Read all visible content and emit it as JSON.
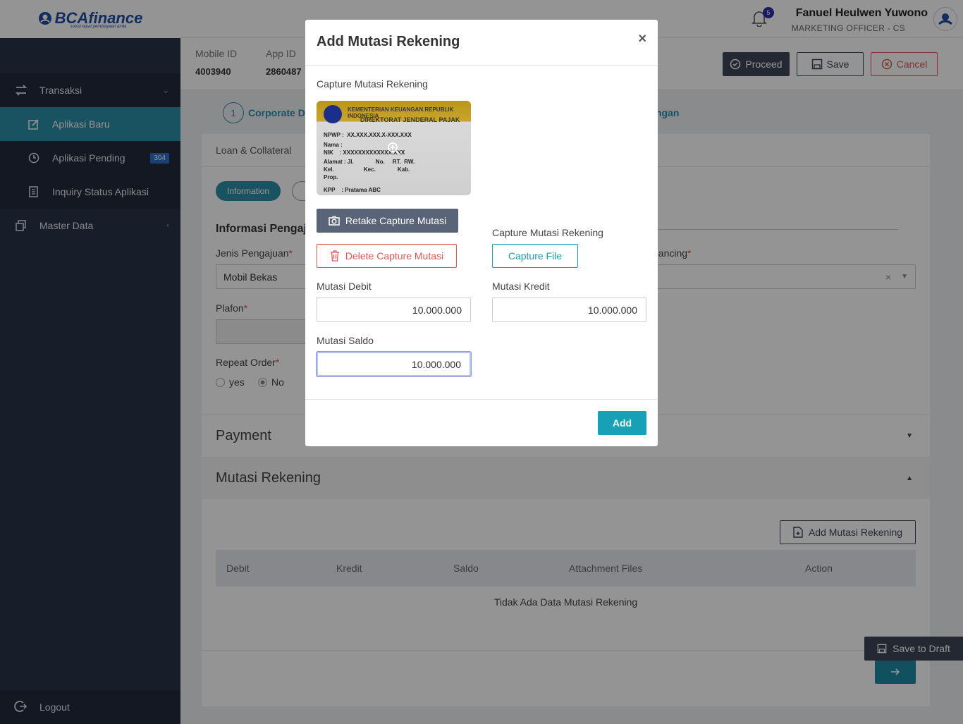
{
  "brand": {
    "name": "BCAfinance",
    "tagline": "solusi tepat pembiayaan anda"
  },
  "sidebar": {
    "items": [
      {
        "label": "Transaksi"
      },
      {
        "label": "Aplikasi Baru"
      },
      {
        "label": "Aplikasi Pending",
        "badge": "304"
      },
      {
        "label": "Inquiry Status Aplikasi"
      },
      {
        "label": "Master Data"
      }
    ],
    "logout": "Logout"
  },
  "header": {
    "notif_count": "5",
    "user_name": "Fanuel Heulwen Yuwono",
    "user_role": "MARKETING OFFICER - CS"
  },
  "infobar": {
    "mobile_id_label": "Mobile ID",
    "mobile_id_value": "4003940",
    "app_id_label": "App ID",
    "app_id_value": "2860487",
    "proceed": "Proceed",
    "save": "Save",
    "cancel": "Cancel"
  },
  "stepper": {
    "num": "1",
    "label": "Corporate D",
    "right_label": "ngan"
  },
  "form": {
    "tab": "Loan & Collateral",
    "pill": "Information",
    "section_title": "Informasi Pengaj",
    "jenis_label": "Jenis Pengajuan",
    "jenis_value": "Mobil Bekas",
    "financing_label": "nancing",
    "plafon_label": "Plafon",
    "repeat_label": "Repeat Order",
    "opt_yes": "yes",
    "opt_no": "No",
    "payment": "Payment",
    "mutasi": "Mutasi Rekening",
    "add_mutasi": "Add Mutasi Rekening",
    "columns": [
      "Debit",
      "Kredit",
      "Saldo",
      "Attachment Files",
      "Action"
    ],
    "empty": "Tidak Ada Data Mutasi Rekening",
    "save_draft": "Save to Draft",
    "req": "*"
  },
  "modal": {
    "title": "Add Mutasi Rekening",
    "close": "×",
    "capture_label_left": "Capture Mutasi Rekening",
    "capture_label_right": "Capture Mutasi Rekening",
    "card": {
      "line1": "KEMENTERIAN KEUANGAN REPUBLIK INDONESIA",
      "line2": "DIREKTORAT JENDERAL PAJAK",
      "npwp": "NPWP :  XX.XXX.XXX.X-XXX.XXX",
      "nama": "Nama :",
      "nik": "NIK    : XXXXXXXXXXXXX.XXX",
      "alamat": "Alamat : Jl.              No.     RT.  RW.",
      "kel": "Kel.                   Kec.              Kab.",
      "prop": "Prop.",
      "kpp": "KPP    : Pratama ABC"
    },
    "retake": "Retake Capture Mutasi",
    "delete": "Delete Capture Mutasi",
    "capture_file": "Capture File",
    "debit_label": "Mutasi Debit",
    "debit_value": "10.000.000",
    "kredit_label": "Mutasi Kredit",
    "kredit_value": "10.000.000",
    "saldo_label": "Mutasi Saldo",
    "saldo_value": "10.000.000",
    "add": "Add"
  },
  "colors": {
    "accent": "#2b8ea7",
    "sidebar": "#293347",
    "danger": "#e05757",
    "dark_button": "#3d4657"
  }
}
